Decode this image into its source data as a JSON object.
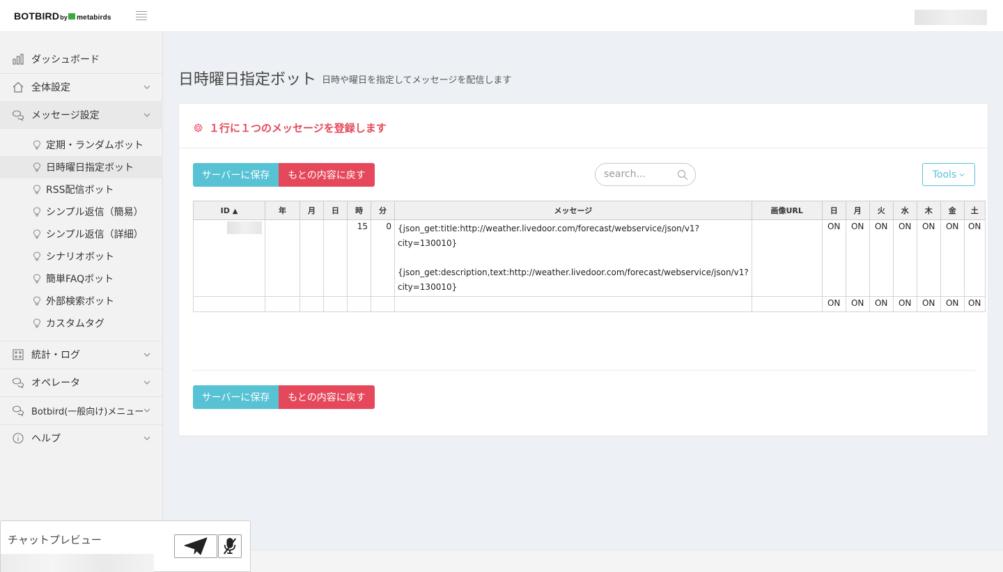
{
  "brand": {
    "main": "BOTBIRD",
    "by": "by",
    "partner": "metabirds"
  },
  "sidebar": {
    "items": [
      {
        "label": "ダッシュボード"
      },
      {
        "label": "全体設定"
      },
      {
        "label": "メッセージ設定"
      },
      {
        "label": "統計・ログ"
      },
      {
        "label": "オペレータ"
      },
      {
        "label": "Botbird(一般向け)メニュー"
      },
      {
        "label": "ヘルプ"
      }
    ],
    "subitems": [
      {
        "label": "定期・ランダムボット"
      },
      {
        "label": "日時曜日指定ボット"
      },
      {
        "label": "RSS配信ボット"
      },
      {
        "label": "シンプル返信（簡易）"
      },
      {
        "label": "シンプル返信（詳細）"
      },
      {
        "label": "シナリオボット"
      },
      {
        "label": "簡単FAQボット"
      },
      {
        "label": "外部検索ボット"
      },
      {
        "label": "カスタムタグ"
      }
    ]
  },
  "page": {
    "title": "日時曜日指定ボット",
    "subtitle": "日時や曜日を指定してメッセージを配信します"
  },
  "panel": {
    "heading": "１行に１つのメッセージを登録します",
    "save_label": "サーバーに保存",
    "revert_label": "もとの内容に戻す",
    "search_placeholder": "search...",
    "tools_label": "Tools"
  },
  "table": {
    "headers": {
      "id": "ID",
      "sort": "▲",
      "year": "年",
      "month": "月",
      "day": "日",
      "hour": "時",
      "minute": "分",
      "message": "メッセージ",
      "image_url": "画像URL",
      "sun": "日",
      "mon": "月",
      "tue": "火",
      "wed": "水",
      "thu": "木",
      "fri": "金",
      "sat": "土"
    },
    "rows": [
      {
        "year": "",
        "month": "",
        "day": "",
        "hour": "15",
        "minute": "0",
        "message": "{json_get:title:http://weather.livedoor.com/forecast/webservice/json/v1?\ncity=130010}\n\n{json_get:description,text:http://weather.livedoor.com/forecast/webservice/json/v1?\ncity=130010}",
        "image_url": "",
        "sun": "ON",
        "mon": "ON",
        "tue": "ON",
        "wed": "ON",
        "thu": "ON",
        "fri": "ON",
        "sat": "ON"
      },
      {
        "year": "",
        "month": "",
        "day": "",
        "hour": "",
        "minute": "",
        "message": "",
        "image_url": "",
        "sun": "ON",
        "mon": "ON",
        "tue": "ON",
        "wed": "ON",
        "thu": "ON",
        "fri": "ON",
        "sat": "ON"
      }
    ]
  },
  "chat": {
    "label": "チャットプレビュー"
  },
  "colors": {
    "accent_teal": "#57c2d3",
    "accent_red": "#e5485a"
  }
}
